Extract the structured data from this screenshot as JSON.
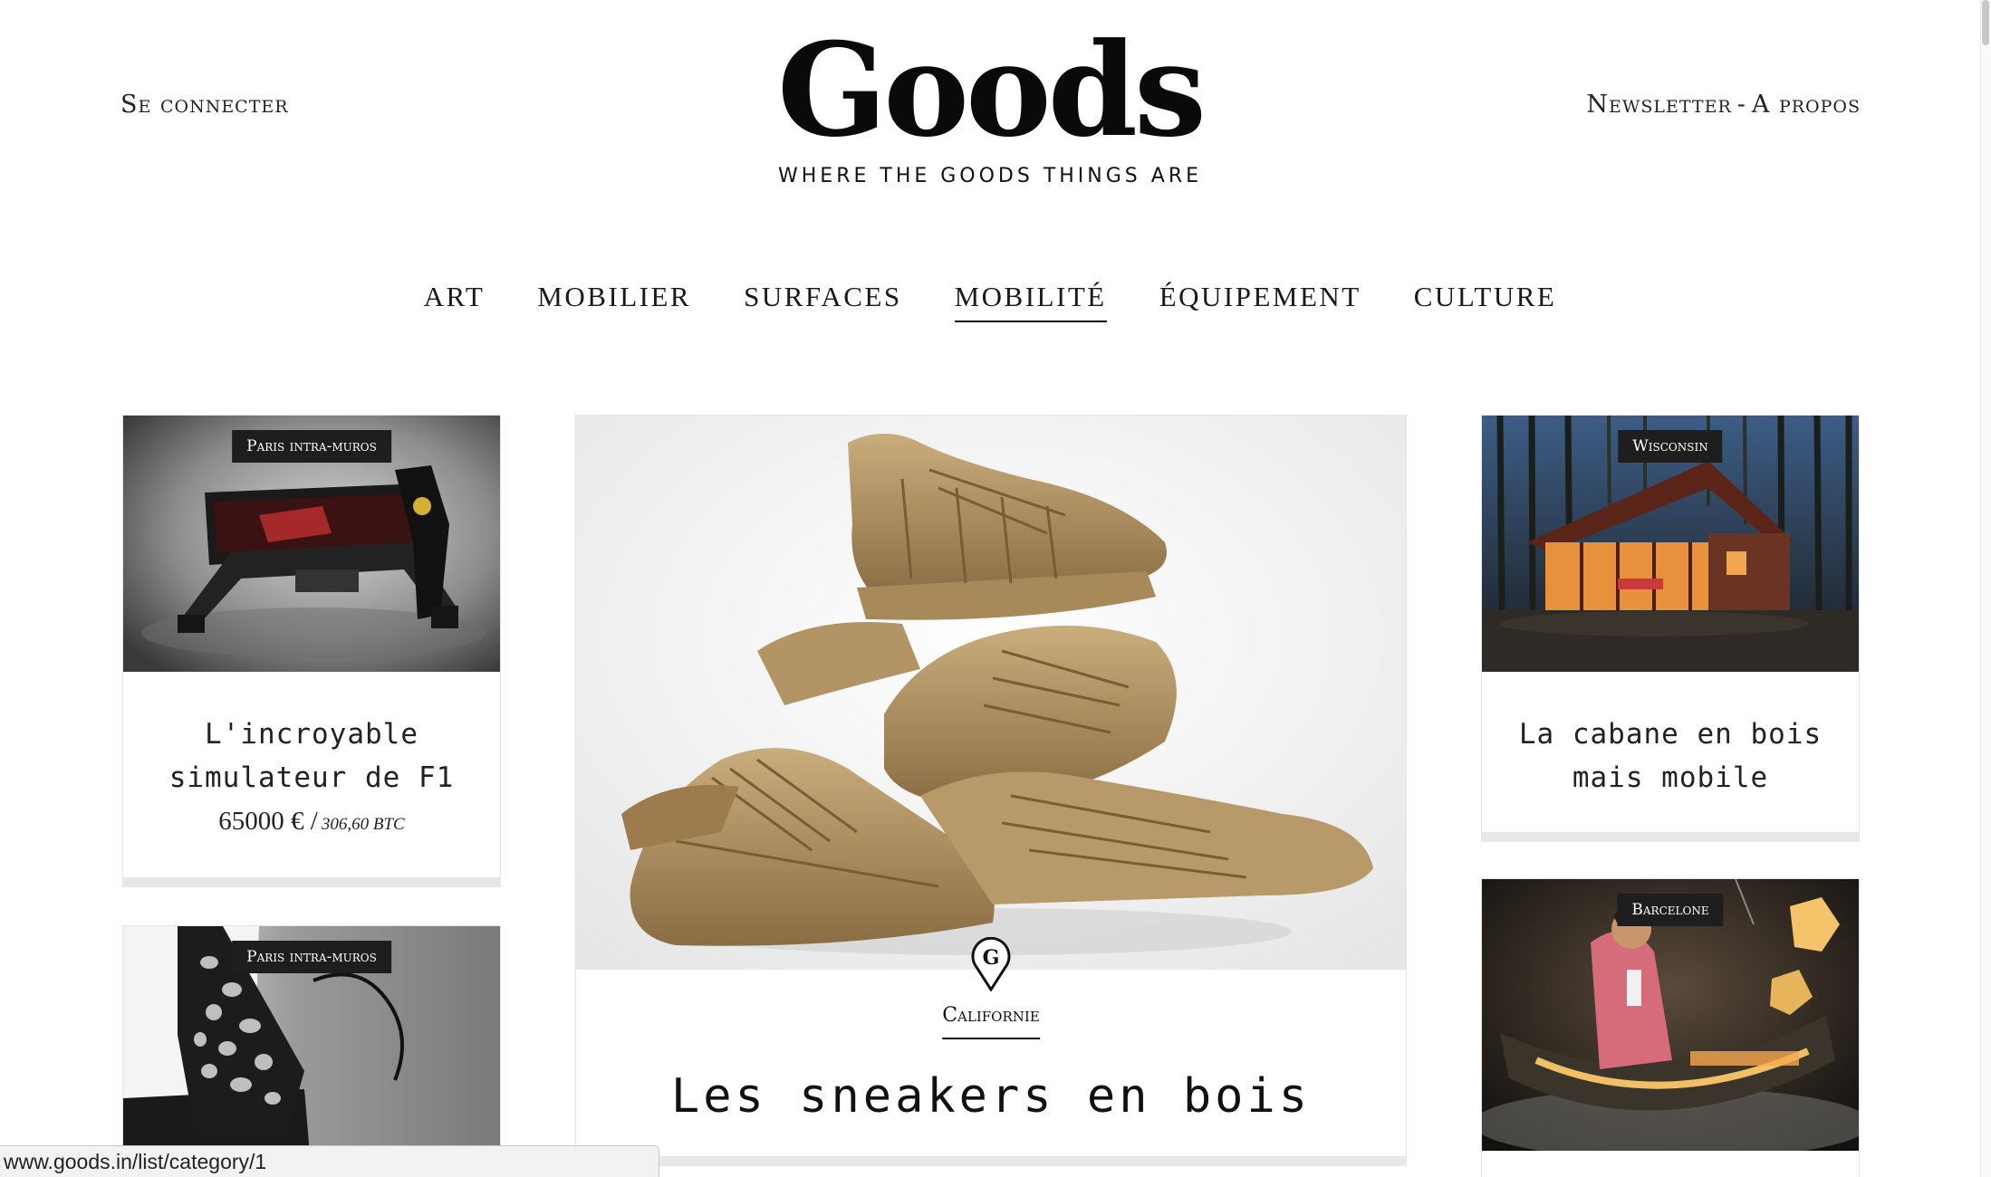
{
  "header": {
    "login_label": "Se connecter",
    "newsletter_label": "Newsletter",
    "separator": "-",
    "about_label": "A propos",
    "logo_text": "Goods",
    "tagline": "WHERE THE GOODS THINGS ARE"
  },
  "nav": {
    "items": [
      {
        "label": "ART"
      },
      {
        "label": "MOBILIER"
      },
      {
        "label": "SURFACES"
      },
      {
        "label": "MOBILITÉ"
      },
      {
        "label": "ÉQUIPEMENT"
      },
      {
        "label": "CULTURE"
      }
    ],
    "active_index": 3
  },
  "cards": {
    "f1": {
      "location": "Paris intra-muros",
      "title_line1": "L'incroyable",
      "title_line2": "simulateur de F1",
      "price": "65000 € /",
      "price_btc": "306,60 BTC"
    },
    "glove": {
      "location": "Paris intra-muros"
    },
    "featured": {
      "pin_letter": "G",
      "location": "Californie",
      "title": "Les sneakers en bois"
    },
    "cabin": {
      "location": "Wisconsin",
      "title_line1": "La cabane en bois",
      "title_line2": "mais mobile"
    },
    "barcelone": {
      "location": "Barcelone"
    }
  },
  "status_bar": {
    "url": "www.goods.in/list/category/1"
  },
  "colors": {
    "text": "#111111",
    "badge_bg": "#1e1e1e",
    "card_shadow": "#e8e8e8"
  }
}
